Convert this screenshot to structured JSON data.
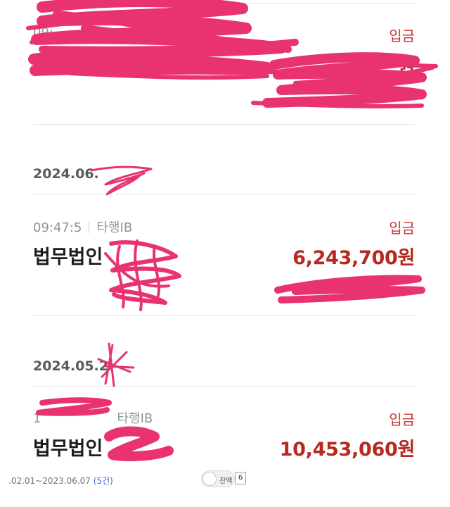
{
  "transactions": [
    {
      "date": "",
      "meta_time": "09:",
      "meta_bank": "",
      "type": "입금",
      "name": "",
      "amount": "원"
    },
    {
      "date": "2024.06.",
      "meta_time": "09:47:5",
      "meta_bank": "타행IB",
      "type": "입금",
      "name": "법무법인",
      "amount": "6,243,700원"
    },
    {
      "date": "2024.05.2",
      "meta_time": "1",
      "meta_bank": "타행IB",
      "type": "입금",
      "name": "법무법인",
      "amount": "10,453,060원"
    }
  ],
  "footer": {
    "period": ".02.01~2023.06.07",
    "count": "(5건)",
    "toggle_label": "잔액",
    "badge": "6"
  },
  "colors": {
    "accent": "#b7281f",
    "redaction": "#e8336f"
  }
}
